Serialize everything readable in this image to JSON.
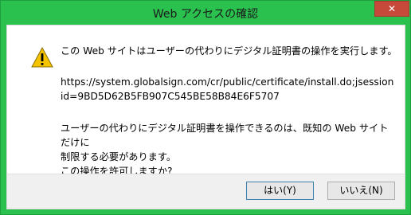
{
  "window": {
    "title": "Web アクセスの確認",
    "close_label": "✕"
  },
  "message": {
    "line1": "この Web サイトはユーザーの代わりにデジタル証明書の操作を実行します。",
    "url": "https://system.globalsign.com/cr/public/certificate/install.do;jsessionid=9BD5D62B5FB907C545BE58B84E6F5707",
    "warning_line1": "ユーザーの代わりにデジタル証明書を操作できるのは、既知の Web サイトだけに",
    "warning_line2": "制限する必要があります。",
    "question": "この操作を許可しますか?"
  },
  "buttons": {
    "yes": "はい(Y)",
    "no": "いいえ(N)"
  },
  "colors": {
    "titlebar": "#2bc14f",
    "close": "#c7493a",
    "icon": "#f5c400"
  },
  "icon": "warning-triangle-icon"
}
